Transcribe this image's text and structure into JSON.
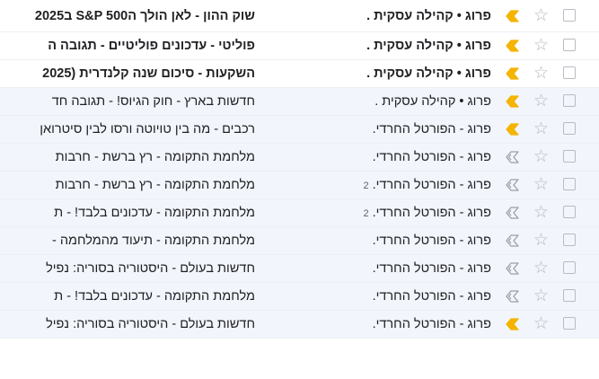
{
  "colors": {
    "important_marker": "#f4b400",
    "important_outline": "#9aa0a6",
    "read_row_bg": "#f2f6fc",
    "unread_row_bg": "#ffffff"
  },
  "icons": {
    "star": "☆",
    "checkbox": "checkbox-icon",
    "important": "importance-marker-icon"
  },
  "emails": [
    {
      "sender": "פרוג • קהילה עסקית .",
      "count": "",
      "subject": "שוק ההון - לאן הולך הS&P 500 ב2025",
      "unread": true,
      "important": "filled"
    },
    {
      "sender": "פרוג • קהילה עסקית .",
      "count": "",
      "subject": "פוליטי - עדכונים פוליטיים - תגובה ה",
      "unread": true,
      "important": "filled"
    },
    {
      "sender": "פרוג • קהילה עסקית .",
      "count": "",
      "subject": "השקעות - סיכום שנה קלנדרית (2025",
      "unread": true,
      "important": "filled"
    },
    {
      "sender": "פרוג • קהילה עסקית .",
      "count": "",
      "subject": "חדשות בארץ - חוק הגיוס! - תגובה חד",
      "unread": false,
      "important": "filled"
    },
    {
      "sender": "פרוג - הפורטל החרדי.",
      "count": "",
      "subject": "רכבים - מה בין טויוטה ורסו לבין סיטרואן",
      "unread": false,
      "important": "filled"
    },
    {
      "sender": "פרוג - הפורטל החרדי.",
      "count": "",
      "subject": "מלחמת התקומה - רץ ברשת - חרבות",
      "unread": false,
      "important": "outline"
    },
    {
      "sender": "פרוג - הפורטל החרדי.",
      "count": "2",
      "subject": "מלחמת התקומה - רץ ברשת - חרבות",
      "unread": false,
      "important": "outline"
    },
    {
      "sender": "פרוג - הפורטל החרדי.",
      "count": "2",
      "subject": "מלחמת התקומה - עדכונים בלבד! - ת",
      "unread": false,
      "important": "outline"
    },
    {
      "sender": "פרוג - הפורטל החרדי.",
      "count": "",
      "subject": "מלחמת התקומה - תיעוד מהמלחמה -",
      "unread": false,
      "important": "outline"
    },
    {
      "sender": "פרוג - הפורטל החרדי.",
      "count": "",
      "subject": "חדשות בעולם - היסטוריה בסוריה: נפיל",
      "unread": false,
      "important": "outline"
    },
    {
      "sender": "פרוג - הפורטל החרדי.",
      "count": "",
      "subject": "מלחמת התקומה - עדכונים בלבד! - ת",
      "unread": false,
      "important": "outline"
    },
    {
      "sender": "פרוג - הפורטל החרדי.",
      "count": "",
      "subject": "חדשות בעולם - היסטוריה בסוריה: נפיל",
      "unread": false,
      "important": "filled"
    }
  ]
}
